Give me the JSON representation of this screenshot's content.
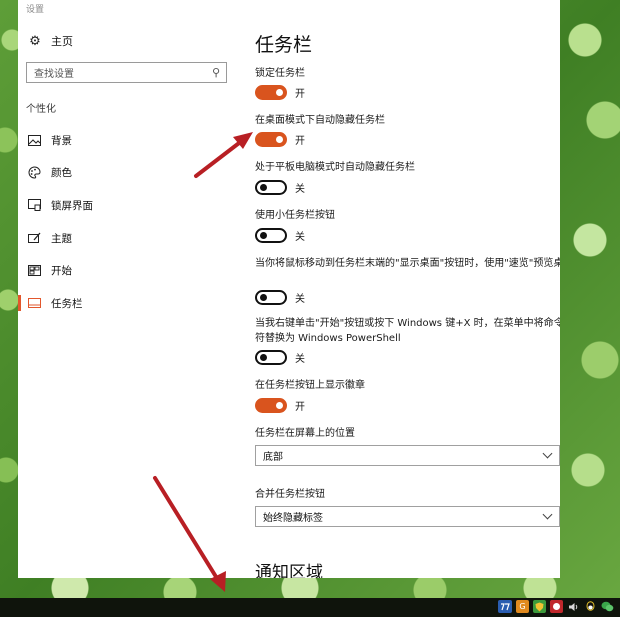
{
  "window": {
    "title": "设置"
  },
  "sidebar": {
    "home": {
      "label": "主页",
      "icon": "gear-icon"
    },
    "search": {
      "placeholder": "查找设置",
      "icon": "search-icon"
    },
    "section_heading": "个性化",
    "items": [
      {
        "label": "背景",
        "icon": "picture-icon",
        "active": false
      },
      {
        "label": "颜色",
        "icon": "palette-icon",
        "active": false
      },
      {
        "label": "锁屏界面",
        "icon": "lock-screen-icon",
        "active": false
      },
      {
        "label": "主题",
        "icon": "theme-brush-icon",
        "active": false
      },
      {
        "label": "开始",
        "icon": "start-grid-icon",
        "active": false
      },
      {
        "label": "任务栏",
        "icon": "taskbar-icon",
        "active": true
      }
    ]
  },
  "main": {
    "title": "任务栏",
    "settings": [
      {
        "label": "锁定任务栏",
        "state": "开",
        "on": true
      },
      {
        "label": "在桌面模式下自动隐藏任务栏",
        "state": "开",
        "on": true
      },
      {
        "label": "处于平板电脑模式时自动隐藏任务栏",
        "state": "关",
        "on": false
      },
      {
        "label": "使用小任务栏按钮",
        "state": "关",
        "on": false
      },
      {
        "label": "当你将鼠标移动到任务栏末端的\"显示桌面\"按钮时，使用\"速览\"预览桌面",
        "state": "关",
        "on": false
      },
      {
        "label": "当我右键单击\"开始\"按钮或按下 Windows 键+X 时，在菜单中将命令提示符替换为 Windows PowerShell",
        "state": "关",
        "on": false
      },
      {
        "label": "在任务栏按钮上显示徽章",
        "state": "开",
        "on": true
      }
    ],
    "position": {
      "label": "任务栏在屏幕上的位置",
      "value": "底部"
    },
    "combine": {
      "label": "合并任务栏按钮",
      "value": "始终隐藏标签"
    },
    "next_section_title": "通知区域"
  },
  "taskbar": {
    "tray_icons": [
      {
        "name": "ime-icon",
        "glyph": "",
        "color": "#2a5db0"
      },
      {
        "name": "g-app-icon",
        "glyph": "G",
        "color": "#e08a1e"
      },
      {
        "name": "shield-icon",
        "glyph": "◆",
        "color": "#3b9a3b"
      },
      {
        "name": "red-app-icon",
        "glyph": "●",
        "color": "#c0282c"
      },
      {
        "name": "sound-icon",
        "glyph": "◗",
        "color": "#6a6a6a"
      },
      {
        "name": "qq-icon",
        "glyph": "●",
        "color": "#d6b320"
      },
      {
        "name": "wechat-icon",
        "glyph": "●",
        "color": "#3aa64a"
      }
    ]
  },
  "colors": {
    "accent": "#d9541e",
    "annotation_arrow": "#b81f24"
  }
}
